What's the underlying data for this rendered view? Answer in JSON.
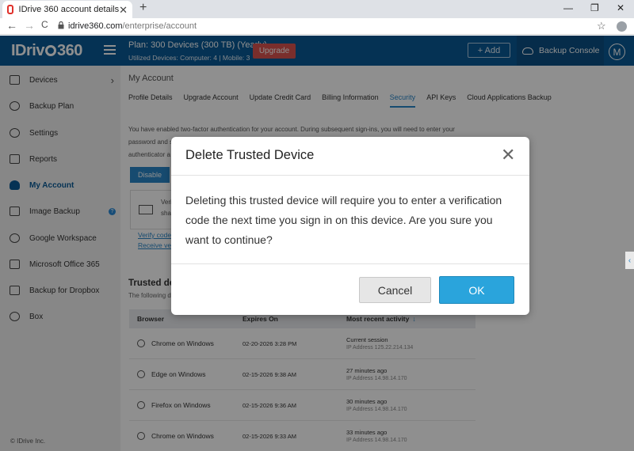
{
  "browser": {
    "tab_title": "IDrive 360 account details",
    "tab_close": "✕",
    "new_tab": "+",
    "url_domain": "idrive360.com",
    "url_path": "/enterprise/account",
    "back": "←",
    "forward": "→",
    "reload": "C",
    "minimize": "—",
    "restore": "❐",
    "close": "✕",
    "bookmark": "☆"
  },
  "header": {
    "logo_pre": "IDriv",
    "logo_post": "360",
    "plan": "Plan: 300 Devices (300 TB) (Yearly)",
    "utilized": "Utilized Devices: Computer: 4 |  Mobile: 3",
    "upgrade": "Upgrade",
    "add": "+ Add",
    "backup_console": "Backup Console",
    "avatar": "M"
  },
  "sidebar": {
    "items": [
      {
        "label": "Devices",
        "icon": "devices-icon"
      },
      {
        "label": "Backup Plan",
        "icon": "backup-plan-icon"
      },
      {
        "label": "Settings",
        "icon": "gear-icon"
      },
      {
        "label": "Reports",
        "icon": "reports-icon"
      },
      {
        "label": "My Account",
        "icon": "user-icon"
      },
      {
        "label": "Image Backup",
        "icon": "image-backup-icon"
      },
      {
        "label": "Google Workspace",
        "icon": "google-icon"
      },
      {
        "label": "Microsoft Office 365",
        "icon": "office-icon"
      },
      {
        "label": "Backup for Dropbox",
        "icon": "dropbox-icon"
      },
      {
        "label": "Box",
        "icon": "box-icon"
      }
    ],
    "devices_arrow": "›",
    "help": "?",
    "copyright": "© IDrive Inc."
  },
  "main": {
    "title": "My Account",
    "tabs": [
      "Profile Details",
      "Upgrade Account",
      "Update Credit Card",
      "Billing Information",
      "Security",
      "API Keys",
      "Cloud Applications Backup"
    ],
    "info_line1": "You have enabled two-factor authentication for your account. During subsequent sign-ins, you will need to enter your",
    "info_line2": "password and s",
    "info_line3": "authenticator a",
    "disable": "Disable",
    "verif_1": "Verif",
    "verif_2": "shar",
    "link_verify": "Verify code",
    "link_receive": "Receive veri",
    "trusted_title": "Trusted de",
    "trusted_sub": "The following d",
    "table": {
      "headers": [
        "Browser",
        "Expires On",
        "Most recent activity"
      ],
      "sort_arrow": "↓",
      "rows": [
        {
          "browser": "Chrome on Windows",
          "expires": "02-20-2026 3:28 PM",
          "activity": "Current session",
          "ip": "IP Address 125.22.214.134"
        },
        {
          "browser": "Edge on Windows",
          "expires": "02-15-2026 9:38 AM",
          "activity": "27 minutes ago",
          "ip": "IP Address 14.98.14.170"
        },
        {
          "browser": "Firefox on Windows",
          "expires": "02-15-2026 9:36 AM",
          "activity": "30 minutes ago",
          "ip": "IP Address 14.98.14.170"
        },
        {
          "browser": "Chrome on Windows",
          "expires": "02-15-2026 9:33 AM",
          "activity": "33 minutes ago",
          "ip": "IP Address 14.98.14.170"
        }
      ]
    }
  },
  "side_expander": "‹",
  "dialog": {
    "title": "Delete Trusted Device",
    "close": "✕",
    "body": "Deleting this trusted device will require you to enter a verification code the next time you sign in on this device. Are you sure you want to continue?",
    "cancel": "Cancel",
    "ok": "OK"
  },
  "colors": {
    "header": "#0a5a96",
    "upgrade": "#d9534f",
    "accent": "#2a86c8",
    "ok_button": "#2aa4dc"
  }
}
